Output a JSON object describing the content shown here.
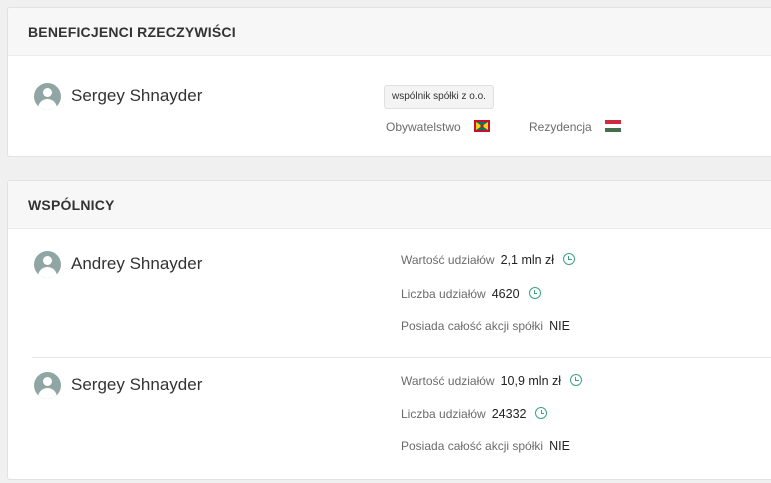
{
  "beneficiaries": {
    "title": "BENEFICJENCI RZECZYWIŚCI",
    "person": {
      "name": "Sergey Shnayder",
      "role_tag": "wspólnik spółki z o.o.",
      "citizenship_label": "Obywatelstwo",
      "residence_label": "Rezydencja"
    }
  },
  "partners": {
    "title": "WSPÓLNICY",
    "items": [
      {
        "name": "Andrey Shnayder",
        "share_value_label": "Wartość udziałów",
        "share_value": "2,1 mln zł",
        "share_count_label": "Liczba udziałów",
        "share_count": "4620",
        "full_ownership_label": "Posiada całość akcji spółki",
        "full_ownership": "NIE"
      },
      {
        "name": "Sergey Shnayder",
        "share_value_label": "Wartość udziałów",
        "share_value": "10,9 mln zł",
        "share_count_label": "Liczba udziałów",
        "share_count": "24332",
        "full_ownership_label": "Posiada całość akcji spółki",
        "full_ownership": "NIE"
      }
    ]
  },
  "colors": {
    "accent": "#3aa37f",
    "avatar": "#8fa6a4"
  },
  "icons": {
    "avatar": "user-avatar-icon",
    "history": "clock-icon",
    "citizenship_flag": "grenada-flag-icon",
    "residence_flag": "hungary-flag-icon"
  }
}
